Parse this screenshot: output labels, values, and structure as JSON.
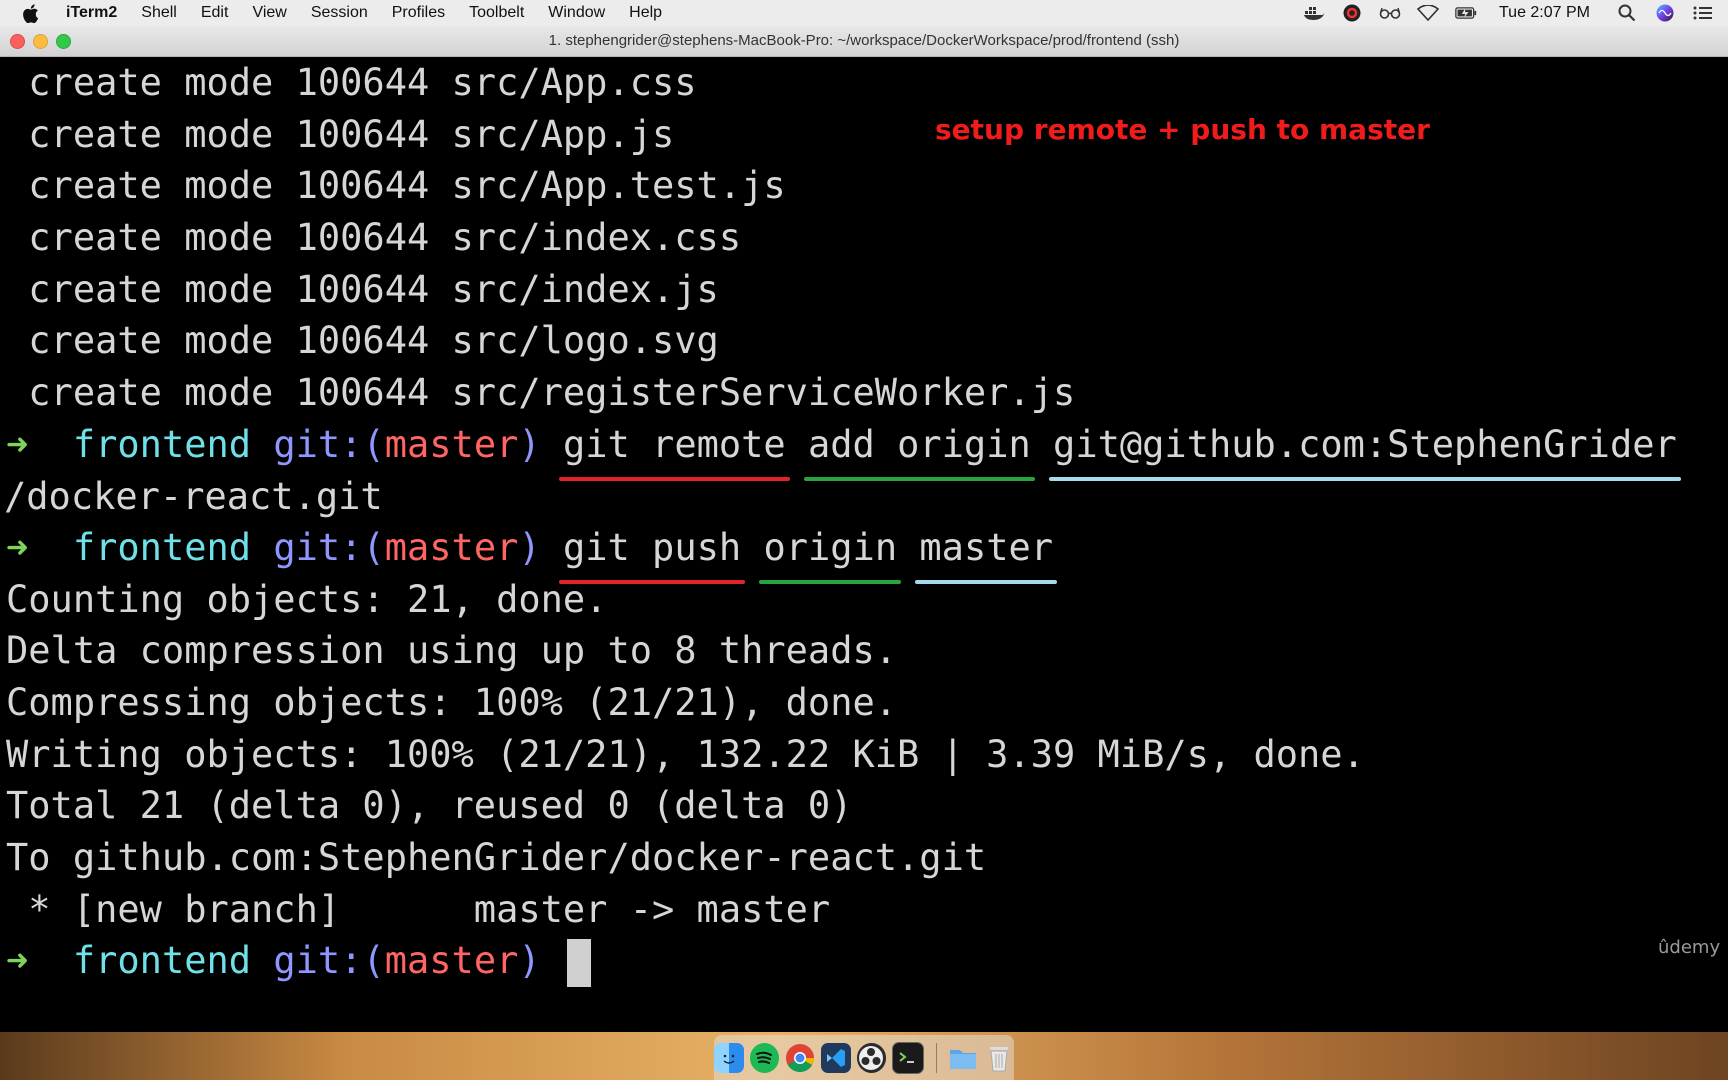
{
  "menubar": {
    "items": [
      "iTerm2",
      "Shell",
      "Edit",
      "View",
      "Session",
      "Profiles",
      "Toolbelt",
      "Window",
      "Help"
    ],
    "icons": [
      "docker-icon",
      "creative-cloud-icon",
      "glasses-icon",
      "wifi-icon",
      "battery-icon"
    ],
    "clock": "Tue 2:07 PM"
  },
  "window": {
    "title": "1. stephengrider@stephens-MacBook-Pro: ~/workspace/DockerWorkspace/prod/frontend (ssh)"
  },
  "annotation": "setup remote + push to master",
  "watermark": "ûdemy",
  "terminal": {
    "create_lines": [
      " create mode 100644 src/App.css",
      " create mode 100644 src/App.js",
      " create mode 100644 src/App.test.js",
      " create mode 100644 src/index.css",
      " create mode 100644 src/index.js",
      " create mode 100644 src/logo.svg",
      " create mode 100644 src/registerServiceWorker.js"
    ],
    "prompt": {
      "arrow": "➜",
      "dir": "frontend",
      "git_open": "git:(",
      "branch": "master",
      "git_close": ")"
    },
    "cmd1": {
      "part1": "git remote",
      "part2": "add origin",
      "part3": "git@github.com:StephenGrider",
      "wrap": "/docker-react.git"
    },
    "cmd2": {
      "part1": "git push",
      "part2": "origin",
      "part3": "master"
    },
    "output": [
      "Counting objects: 21, done.",
      "Delta compression using up to 8 threads.",
      "Compressing objects: 100% (21/21), done.",
      "Writing objects: 100% (21/21), 132.22 KiB | 3.39 MiB/s, done.",
      "Total 21 (delta 0), reused 0 (delta 0)",
      "To github.com:StephenGrider/docker-react.git",
      " * [new branch]      master -> master"
    ]
  },
  "dock": {
    "apps": [
      "finder-icon",
      "spotify-icon",
      "chrome-icon",
      "vscode-icon",
      "obs-icon",
      "terminal-icon",
      "folder-icon",
      "trash-icon"
    ]
  }
}
